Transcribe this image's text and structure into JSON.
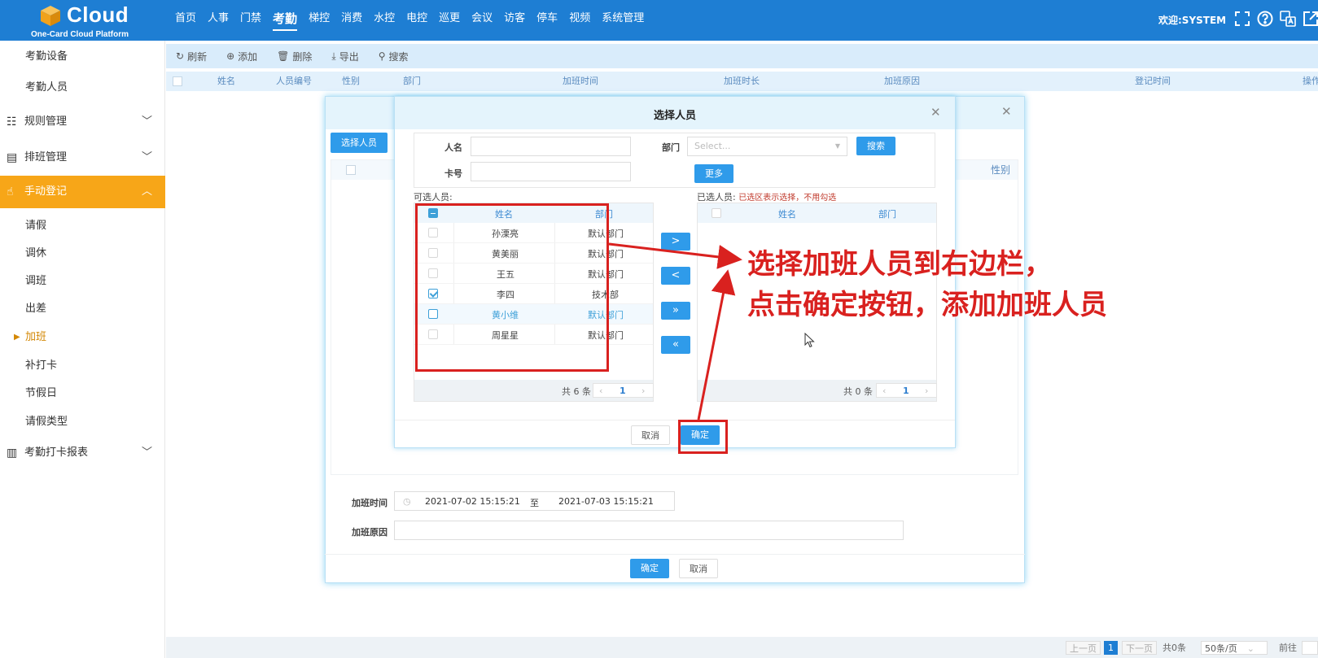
{
  "header": {
    "logo_word": "Cloud",
    "logo_sub": "One-Card Cloud Platform",
    "nav": [
      "首页",
      "人事",
      "门禁",
      "考勤",
      "梯控",
      "消费",
      "水控",
      "电控",
      "巡更",
      "会议",
      "访客",
      "停车",
      "视频",
      "系统管理"
    ],
    "active_nav": "考勤",
    "welcome": "欢迎:SYSTEM",
    "colors": {
      "topbar": "#1e7ed3",
      "accent": "#f7a618",
      "annotation": "#d9211f"
    }
  },
  "sidebar": {
    "top_items": [
      "考勤设备",
      "考勤人员"
    ],
    "groups": {
      "rules": "规则管理",
      "schedule": "排班管理",
      "manual": "手动登记",
      "report": "考勤打卡报表"
    },
    "manual_items": [
      "请假",
      "调休",
      "调班",
      "出差",
      "加班",
      "补打卡",
      "节假日",
      "请假类型"
    ],
    "current_item": "加班"
  },
  "toolbar": {
    "refresh": "刷新",
    "add": "添加",
    "delete": "删除",
    "export": "导出",
    "search": "搜索"
  },
  "table": {
    "columns": [
      "姓名",
      "人员编号",
      "性别",
      "部门",
      "加班时间",
      "加班时长",
      "加班原因",
      "登记时间",
      "操作"
    ]
  },
  "pager": {
    "prev": "上一页",
    "current": "1",
    "next": "下一页",
    "total": "共0条",
    "page_size": "50条/页",
    "goto": "前往"
  },
  "outer_dialog": {
    "select_person_btn": "选择人员",
    "sex_column": "性别",
    "overtime_time_label": "加班时间",
    "start_time": "2021-07-02 15:15:21",
    "to": "至",
    "end_time": "2021-07-03 15:15:21",
    "reason_label": "加班原因",
    "ok": "确定",
    "cancel": "取消"
  },
  "inner_dialog": {
    "title": "选择人员",
    "name_label": "人名",
    "card_label": "卡号",
    "dept_label": "部门",
    "dept_placeholder": "Select...",
    "search_btn": "搜索",
    "more_btn": "更多",
    "available_label": "可选人员:",
    "selected_label": "已选人员:",
    "selected_hint": "已选区表示选择，不用勾选",
    "col_name": "姓名",
    "col_dept": "部门",
    "available": [
      {
        "name": "孙溧亮",
        "dept": "默认部门",
        "checked": false
      },
      {
        "name": "黄美丽",
        "dept": "默认部门",
        "checked": false
      },
      {
        "name": "王五",
        "dept": "默认部门",
        "checked": false
      },
      {
        "name": "李四",
        "dept": "技术部",
        "checked": true
      },
      {
        "name": "黄小维",
        "dept": "默认部门",
        "checked": false
      },
      {
        "name": "周星星",
        "dept": "默认部门",
        "checked": false
      }
    ],
    "available_count": "共 6 条",
    "selected_count": "共 0 条",
    "page": "1",
    "transfer": [
      ">",
      "<",
      "»",
      "«"
    ],
    "cancel": "取消",
    "ok": "确定"
  },
  "annotation": {
    "line1": "选择加班人员到右边栏，",
    "line2": "点击确定按钮，添加加班人员"
  }
}
